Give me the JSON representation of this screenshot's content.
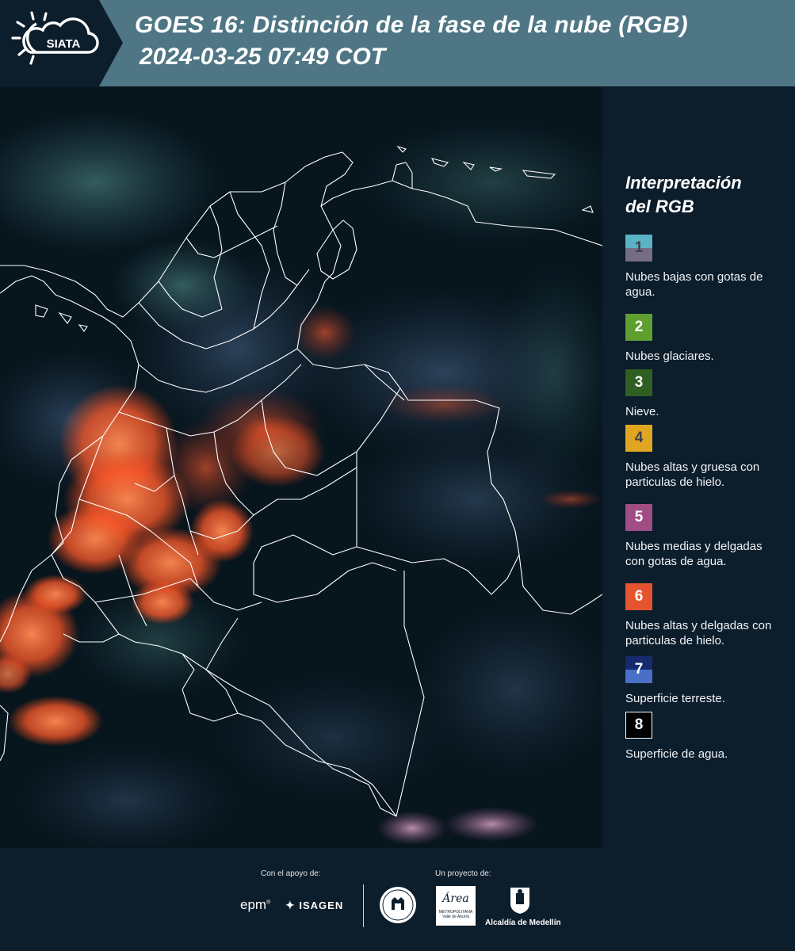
{
  "header": {
    "logo_text": "SIATA",
    "title": "GOES 16: Distinción de la fase de la nube (RGB)",
    "subtitle": "2024-03-25 07:49 COT"
  },
  "legend": {
    "title_line1": "Interpretación",
    "title_line2": "del RGB",
    "items": [
      {
        "num": "1",
        "text": "Nubes bajas con gotas de agua.",
        "color_top": "#5ab3c4",
        "color_bottom": "#756c86"
      },
      {
        "num": "2",
        "text": "Nubes glaciares.",
        "color_top": "#5e9f2f",
        "color_bottom": "#5e9f2f"
      },
      {
        "num": "3",
        "text": "Nieve.",
        "color_top": "#2f5f22",
        "color_bottom": "#2f5f22"
      },
      {
        "num": "4",
        "text": "Nubes altas y gruesa con particulas de hielo.",
        "color_top": "#e0a621",
        "color_bottom": "#e0a621"
      },
      {
        "num": "5",
        "text": "Nubes medias y delgadas con gotas de agua.",
        "color_top": "#a24c86",
        "color_bottom": "#a24c86"
      },
      {
        "num": "6",
        "text": "Nubes altas y delgadas con particulas de hielo.",
        "color_top": "#e5542e",
        "color_bottom": "#e5542e"
      },
      {
        "num": "7",
        "text": "Superficie terreste.",
        "color_top": "#162a6e",
        "color_bottom": "#4a6fc6"
      },
      {
        "num": "8",
        "text": "Superficie de agua.",
        "color_top": "#000000",
        "color_bottom": "#000000"
      }
    ]
  },
  "footer": {
    "support_label": "Con el apoyo de:",
    "project_label": "Un proyecto de:",
    "epm": "epm",
    "isagen": "ISAGEN",
    "area_line1": "Área",
    "area_line2": "METROPOLITANA",
    "area_line3": "Valle de Aburrá",
    "alcaldia": "Alcaldía de Medellín"
  },
  "colors": {
    "header_bg": "#4f7684",
    "page_bg": "#0c1d2b",
    "cloud_orange": "#ff6a2e",
    "border_white": "#ffffff"
  }
}
